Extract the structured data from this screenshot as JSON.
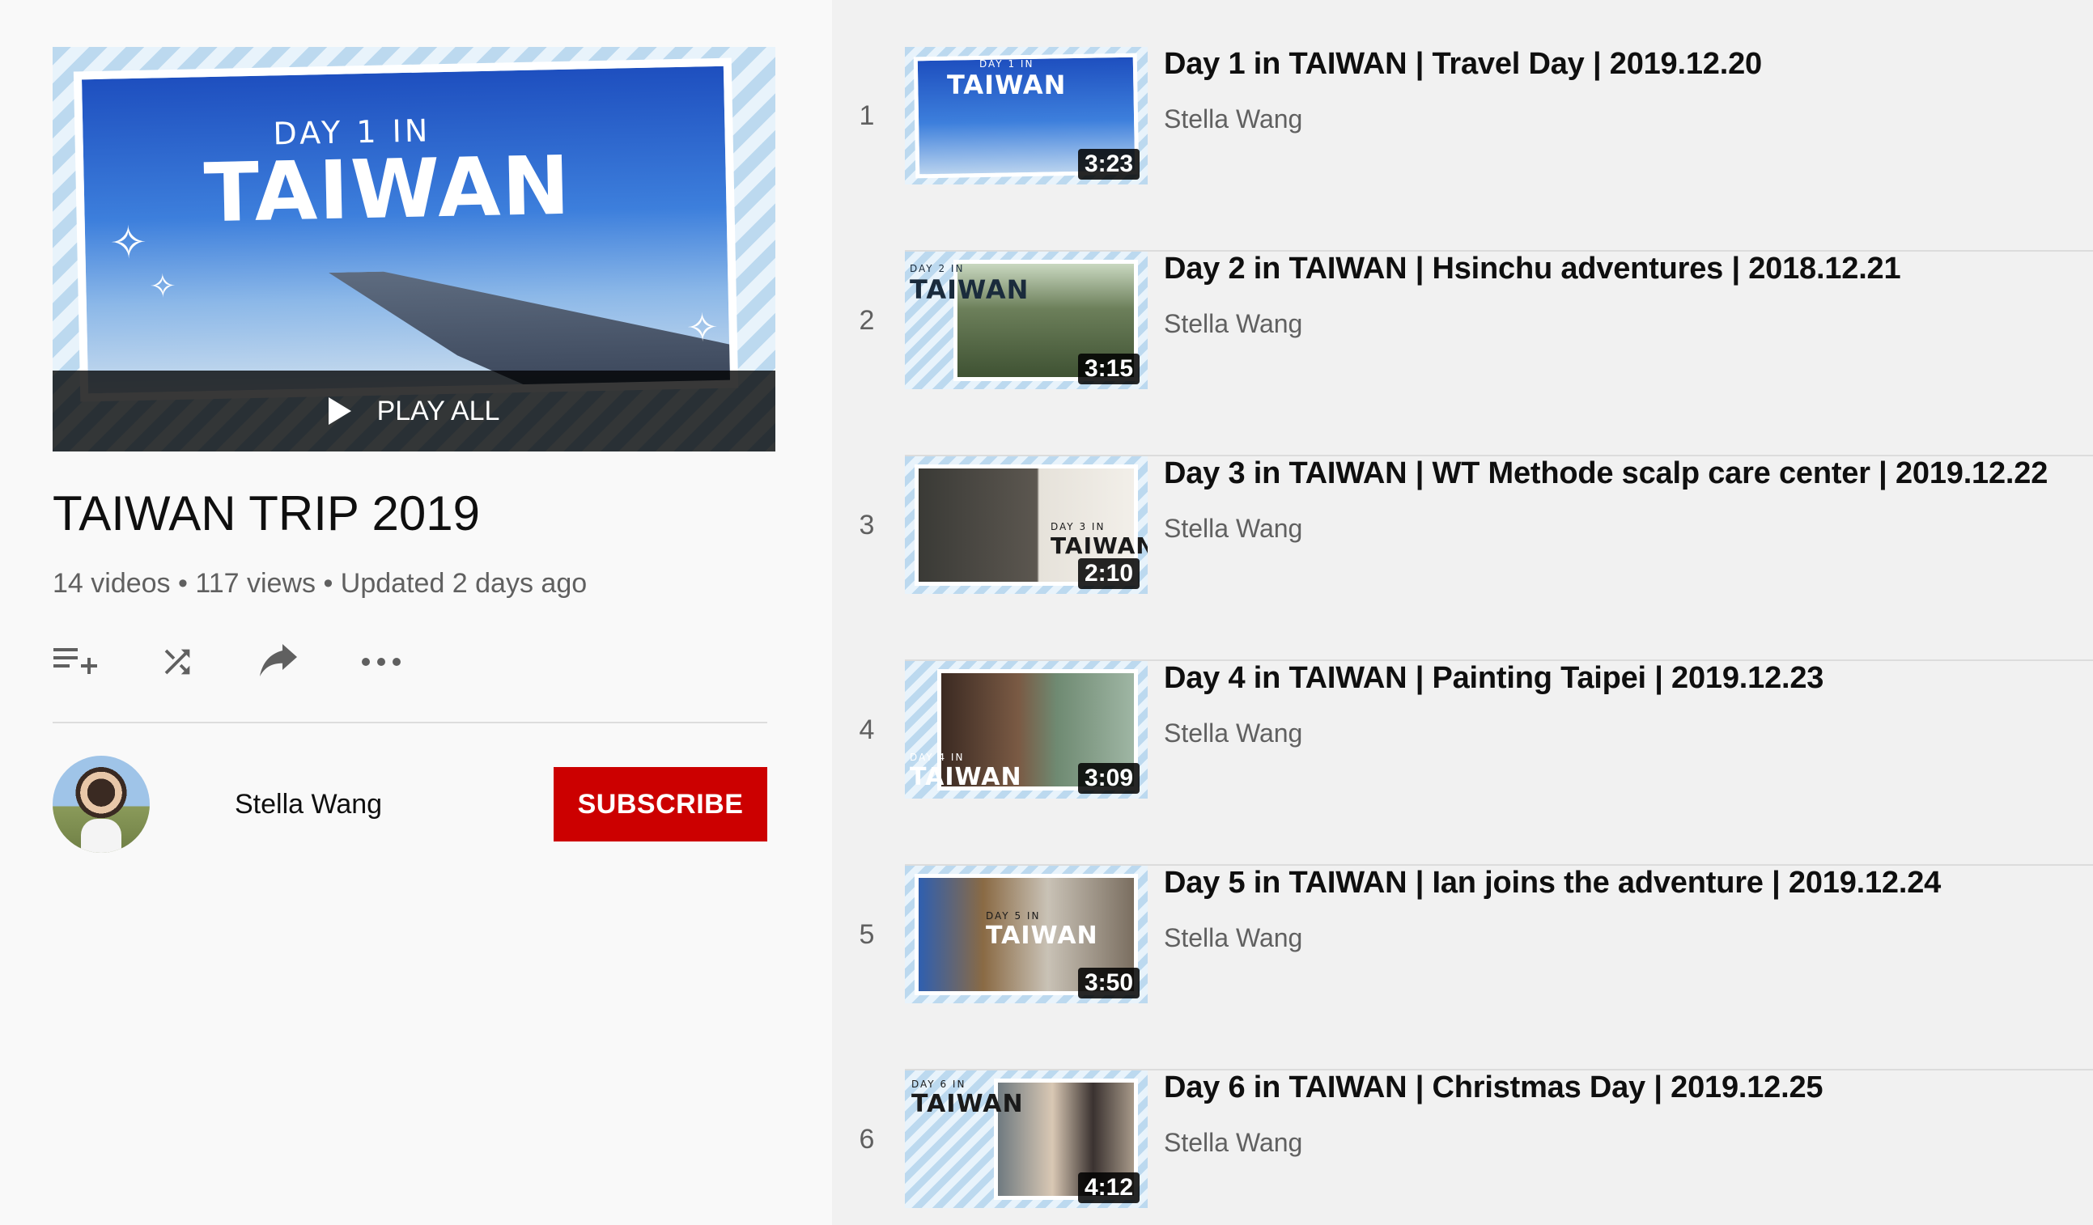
{
  "playlist": {
    "hero_day_label": "DAY 1 IN",
    "hero_title": "TAIWAN",
    "play_all_label": "PLAY ALL",
    "title": "TAIWAN TRIP 2019",
    "stats": "14 videos • 117 views • Updated 2 days ago",
    "actions": [
      "add-to-queue-icon",
      "shuffle-icon",
      "share-icon",
      "more-icon"
    ]
  },
  "owner": {
    "name": "Stella Wang",
    "subscribe_label": "SUBSCRIBE"
  },
  "colors": {
    "subscribe_bg": "#cc0000",
    "sidebar_bg": "#f9f9f9",
    "list_bg": "#f1f1f1"
  },
  "videos": [
    {
      "index": "1",
      "title": "Day 1 in TAIWAN | Travel Day | 2019.12.20",
      "channel": "Stella Wang",
      "duration": "3:23",
      "thumb_day": "DAY 1 IN",
      "thumb_title": "TAIWAN"
    },
    {
      "index": "2",
      "title": "Day 2 in TAIWAN | Hsinchu adventures | 2018.12.21",
      "channel": "Stella Wang",
      "duration": "3:15",
      "thumb_day": "DAY 2 IN",
      "thumb_title": "TAIWAN"
    },
    {
      "index": "3",
      "title": "Day 3 in TAIWAN | WT Methode scalp care center | 2019.12.22",
      "channel": "Stella Wang",
      "duration": "2:10",
      "thumb_day": "DAY 3 IN",
      "thumb_title": "TAIWAN"
    },
    {
      "index": "4",
      "title": "Day 4 in TAIWAN | Painting Taipei | 2019.12.23",
      "channel": "Stella Wang",
      "duration": "3:09",
      "thumb_day": "DAY 4 IN",
      "thumb_title": "TAIWAN"
    },
    {
      "index": "5",
      "title": "Day 5 in TAIWAN | Ian joins the adventure | 2019.12.24",
      "channel": "Stella Wang",
      "duration": "3:50",
      "thumb_day": "DAY 5 IN",
      "thumb_title": "TAIWAN"
    },
    {
      "index": "6",
      "title": "Day 6 in TAIWAN | Christmas Day | 2019.12.25",
      "channel": "Stella Wang",
      "duration": "4:12",
      "thumb_day": "DAY 6 IN",
      "thumb_title": "TAIWAN"
    }
  ]
}
